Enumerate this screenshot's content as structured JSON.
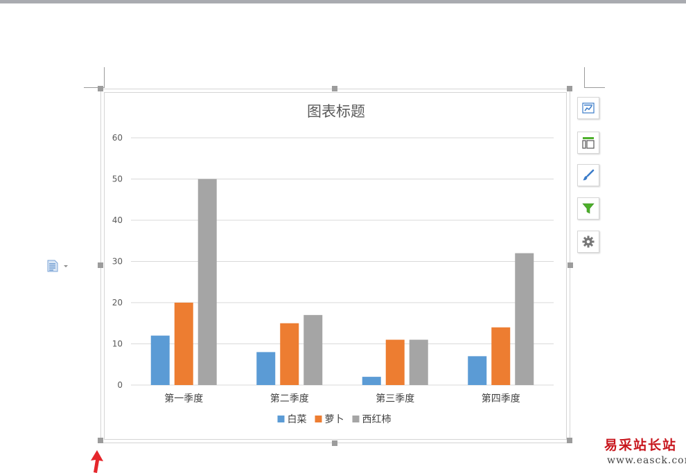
{
  "chart_data": {
    "type": "bar",
    "title": "图表标题",
    "categories": [
      "第一季度",
      "第二季度",
      "第三季度",
      "第四季度"
    ],
    "series": [
      {
        "name": "白菜",
        "color": "#5b9bd5",
        "values": [
          12,
          8,
          2,
          7
        ]
      },
      {
        "name": "萝卜",
        "color": "#ed7d31",
        "values": [
          20,
          15,
          11,
          14
        ]
      },
      {
        "name": "西红柿",
        "color": "#a5a5a5",
        "values": [
          50,
          17,
          11,
          32
        ]
      }
    ],
    "yticks": [
      0,
      10,
      20,
      30,
      40,
      50,
      60
    ],
    "ylim": [
      0,
      60
    ],
    "xlabel": "",
    "ylabel": "",
    "grid": true,
    "legend": "bottom"
  },
  "side_toolbar": {
    "icons": [
      "chart-elements-icon",
      "chart-layout-icon",
      "chart-style-icon",
      "chart-filter-icon",
      "chart-settings-icon"
    ]
  },
  "watermark": {
    "top": "易采站长站",
    "bottom": "www.easck.com"
  },
  "colors": {
    "accent_blue": "#5b9bd5",
    "arrow_red": "#e5262b",
    "filter_green": "#4caf2a"
  }
}
